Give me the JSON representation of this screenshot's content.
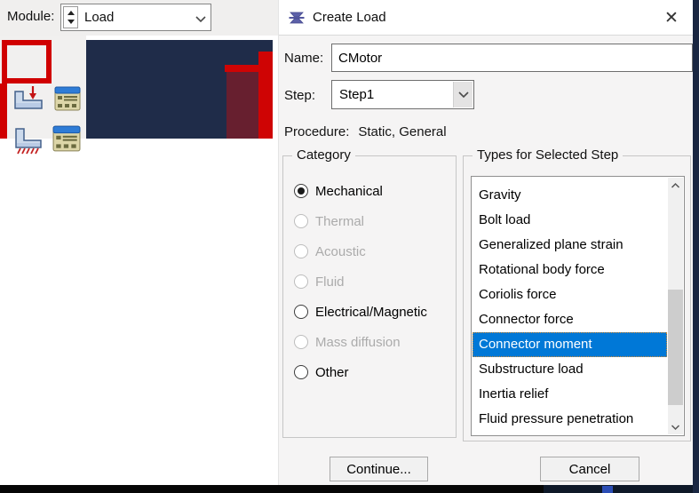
{
  "module_bar": {
    "label": "Module:",
    "value": "Load"
  },
  "toolbox": {
    "icons": [
      "create-load-icon",
      "load-manager-icon",
      "create-bc-icon",
      "bc-manager-icon"
    ]
  },
  "viewport": {
    "colors": {
      "background": "#1f2c49",
      "part": "#671f2f",
      "highlight": "#cf0404"
    }
  },
  "annotation": {
    "color": "#d00000"
  },
  "dialog": {
    "title": "Create Load",
    "close_glyph": "✕",
    "name_field": {
      "label": "Name:",
      "value": "CMotor"
    },
    "step_field": {
      "label": "Step:",
      "value": "Step1"
    },
    "procedure": {
      "label": "Procedure:",
      "value": "Static, General"
    },
    "category": {
      "legend": "Category",
      "options": [
        {
          "label": "Mechanical",
          "selected": true,
          "enabled": true
        },
        {
          "label": "Thermal",
          "selected": false,
          "enabled": false
        },
        {
          "label": "Acoustic",
          "selected": false,
          "enabled": false
        },
        {
          "label": "Fluid",
          "selected": false,
          "enabled": false
        },
        {
          "label": "Electrical/Magnetic",
          "selected": false,
          "enabled": true
        },
        {
          "label": "Mass diffusion",
          "selected": false,
          "enabled": false
        },
        {
          "label": "Other",
          "selected": false,
          "enabled": true
        }
      ]
    },
    "types": {
      "legend": "Types for Selected Step",
      "items": [
        "Gravity",
        "Bolt load",
        "Generalized plane strain",
        "Rotational body force",
        "Coriolis force",
        "Connector force",
        "Connector moment",
        "Substructure load",
        "Inertia relief",
        "Fluid pressure penetration"
      ],
      "selected": "Connector moment",
      "selection_color": "#0078d7"
    },
    "buttons": {
      "continue": "Continue...",
      "cancel": "Cancel"
    }
  }
}
